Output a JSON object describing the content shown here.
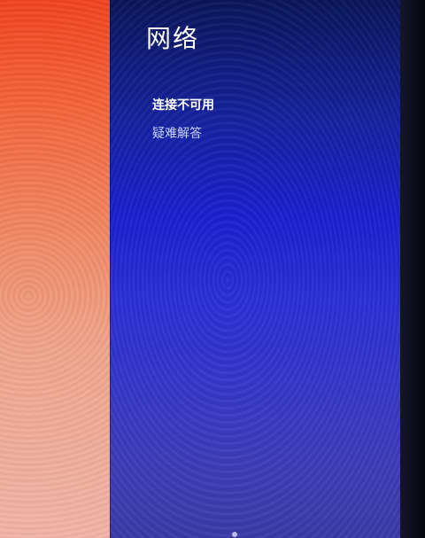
{
  "network_panel": {
    "title": "网络",
    "status_text": "连接不可用",
    "troubleshoot_label": "疑难解答"
  },
  "colors": {
    "panel_accent": "#1a1fcf",
    "desktop_accent": "#f0431f"
  }
}
